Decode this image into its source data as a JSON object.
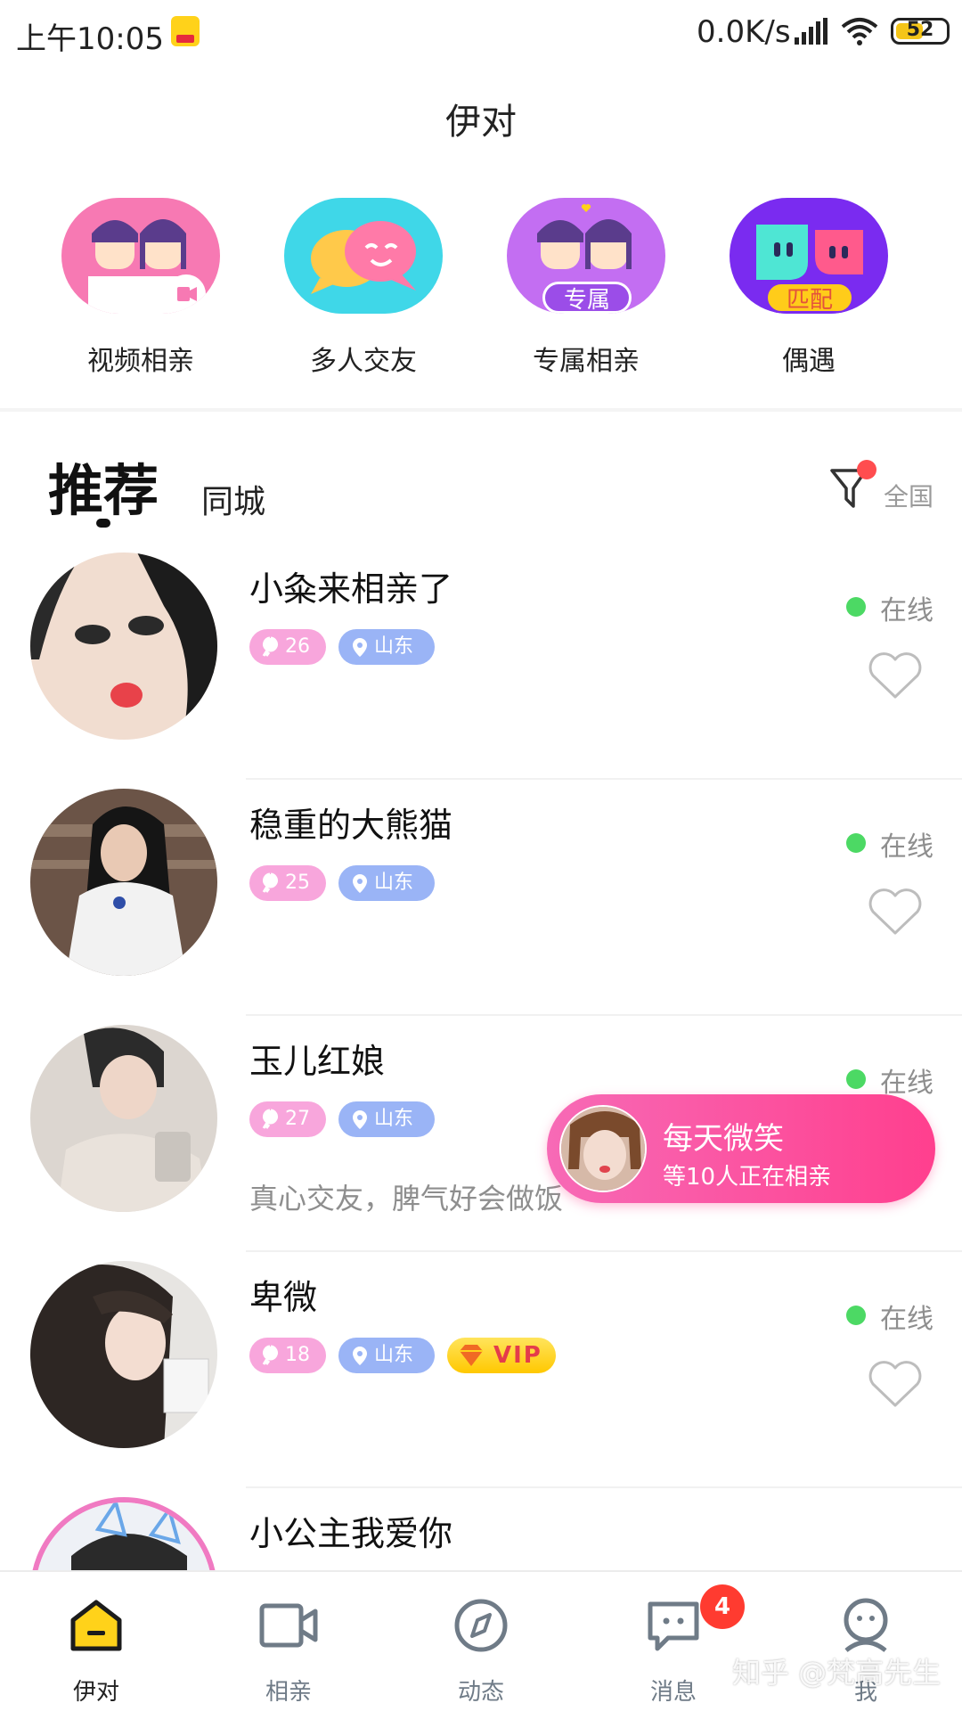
{
  "status_bar": {
    "time": "上午10:05",
    "net_speed": "0.0K/s",
    "battery": "52"
  },
  "title": "伊对",
  "quick_actions": [
    {
      "label": "视频相亲",
      "icon": "video-date-icon"
    },
    {
      "label": "多人交友",
      "icon": "group-chat-icon"
    },
    {
      "label": "专属相亲",
      "icon": "exclusive-date-icon",
      "tag": "专属"
    },
    {
      "label": "偶遇",
      "icon": "match-icon",
      "tag": "匹配"
    }
  ],
  "tabs": {
    "recommend": "推荐",
    "same_city": "同城",
    "region": "全国"
  },
  "users": [
    {
      "name": "小粂来相亲了",
      "age": "26",
      "location": "山东",
      "status": "在线",
      "bio": "",
      "vip": ""
    },
    {
      "name": "稳重的大熊猫",
      "age": "25",
      "location": "山东",
      "status": "在线",
      "bio": "",
      "vip": ""
    },
    {
      "name": "玉儿红娘",
      "age": "27",
      "location": "山东",
      "status": "在线",
      "bio": "真心交友，脾气好会做饭",
      "vip": ""
    },
    {
      "name": "卑微",
      "age": "18",
      "location": "山东",
      "status": "在线",
      "bio": "",
      "vip": "VIP"
    },
    {
      "name": "小公主我爱你",
      "age": "",
      "location": "",
      "status": "",
      "bio": "",
      "vip": ""
    }
  ],
  "floating_banner": {
    "title": "每天微笑",
    "subtitle": "等10人正在相亲"
  },
  "bottom_nav": [
    {
      "label": "伊对",
      "icon": "home-icon",
      "active": true
    },
    {
      "label": "相亲",
      "icon": "video-camera-icon",
      "active": false
    },
    {
      "label": "动态",
      "icon": "compass-icon",
      "active": false
    },
    {
      "label": "消息",
      "icon": "message-icon",
      "active": false,
      "badge": "4"
    },
    {
      "label": "我",
      "icon": "profile-icon",
      "active": false
    }
  ],
  "watermark": "知乎 @梵高先生",
  "colors": {
    "accent_yellow": "#ffd21a",
    "pink": "#ff3f8e",
    "online_green": "#4cd964",
    "badge_red": "#ff3b30"
  }
}
